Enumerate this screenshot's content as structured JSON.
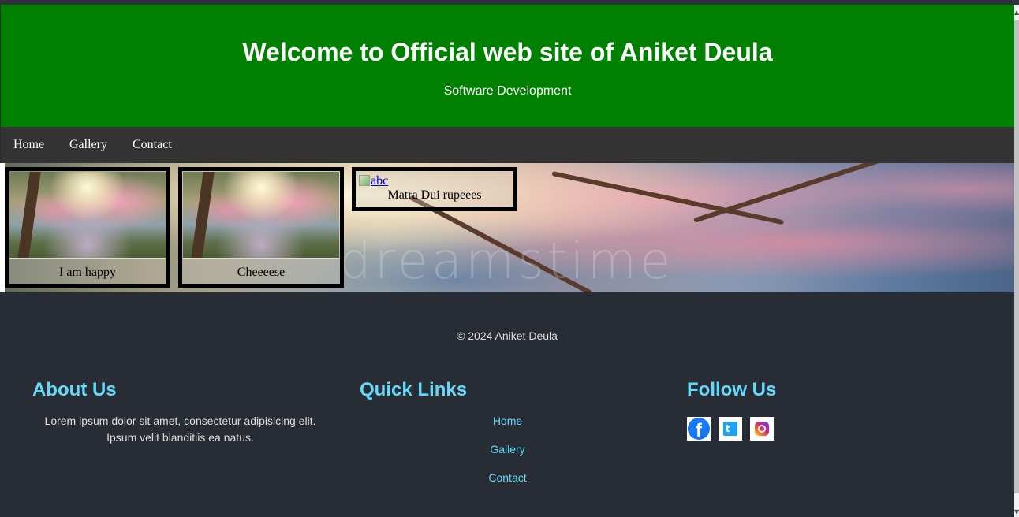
{
  "header": {
    "title": "Welcome to Official web site of Aniket Deula",
    "subtitle": "Software Development",
    "background_color": "#008000"
  },
  "nav": {
    "items": [
      {
        "label": "Home"
      },
      {
        "label": "Gallery"
      },
      {
        "label": "Contact"
      }
    ]
  },
  "gallery": {
    "cards": [
      {
        "caption": "I am happy",
        "image": "cherry-blossom-thumbnail"
      },
      {
        "caption": "Cheeeese",
        "image": "cherry-blossom-thumbnail"
      },
      {
        "caption": "Matra Dui rupeees",
        "image_alt": "abc",
        "image": "broken-image-icon"
      }
    ],
    "background_watermark": "dreamstime"
  },
  "footer": {
    "copyright": "© 2024 Aniket Deula",
    "about": {
      "heading": "About Us",
      "text": "Lorem ipsum dolor sit amet, consectetur adipisicing elit. Ipsum velit blanditiis ea natus."
    },
    "quick_links": {
      "heading": "Quick Links",
      "links": [
        {
          "label": "Home"
        },
        {
          "label": "Gallery"
        },
        {
          "label": "Contact"
        }
      ]
    },
    "follow": {
      "heading": "Follow Us",
      "icons": [
        "facebook-icon",
        "twitter-icon",
        "instagram-icon"
      ]
    },
    "accent_color": "#61dafb",
    "background_color": "#282c34"
  }
}
